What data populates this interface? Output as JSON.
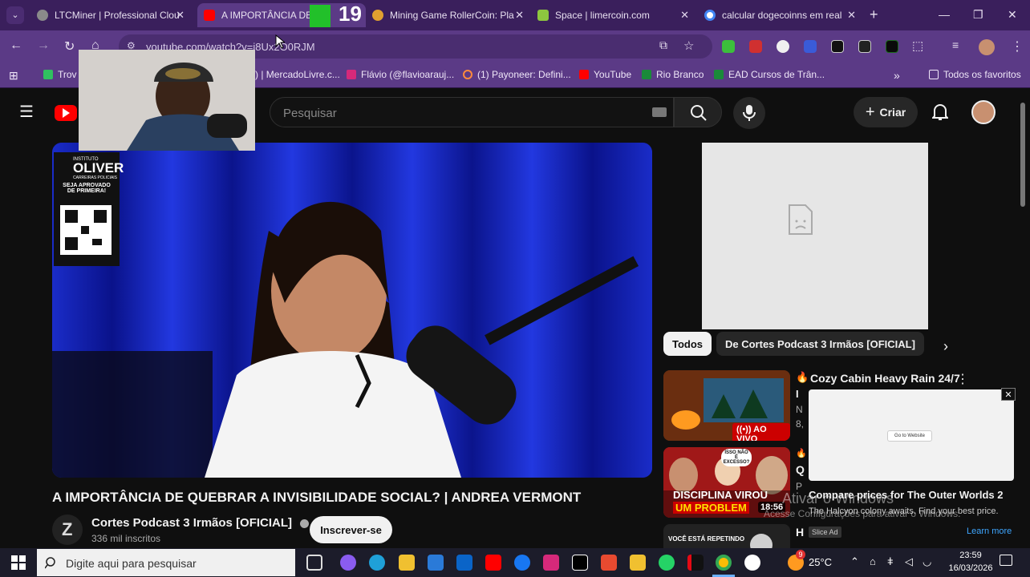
{
  "browser": {
    "tabs": [
      {
        "label": "LTCMiner | Professional Clou",
        "active": false
      },
      {
        "label": "A IMPORTÂNCIA DE Q",
        "active": true
      },
      {
        "label": "Mining Game RollerCoin: Pla",
        "active": false
      },
      {
        "label": "Space | limercoin.com",
        "active": false
      },
      {
        "label": "calcular dogecoinns em real",
        "active": false
      }
    ],
    "overlay_badge": "19",
    "new_tab": "+",
    "url": "youtube.com/watch?v=j8Ux2O0RJM",
    "bookmarks": [
      {
        "label": "Trov"
      },
      {
        "label": ") | MercadoLivre.c..."
      },
      {
        "label": "Flávio (@flavioarauj..."
      },
      {
        "label": "(1) Payoneer: Defini..."
      },
      {
        "label": "YouTube"
      },
      {
        "label": "Rio Branco"
      },
      {
        "label": "EAD Cursos de Trân..."
      }
    ],
    "all_bookmarks": "Todos os favoritos"
  },
  "youtube": {
    "search_placeholder": "Pesquisar",
    "create_label": "Criar",
    "video_title": "A IMPORTÂNCIA DE QUEBRAR A INVISIBILIDADE SOCIAL? | ANDREA VERMONT",
    "channel_name": "Cortes Podcast 3 Irmãos [OFICIAL]",
    "subscribers": "336 mil inscritos",
    "subscribe_label": "Inscrever-se",
    "video_overlay": {
      "brand": "OLIVER",
      "brand_top": "INSTITUTO",
      "brand_sub": "CARREIRAS POLICIAIS",
      "slogan": "SEJA APROVADO DE PRIMEIRA!"
    },
    "chips": [
      "Todos",
      "De Cortes Podcast 3 Irmãos [OFICIAL]"
    ],
    "recommendations": [
      {
        "title": "Cozy Cabin Heavy Rain 24/7",
        "badge": "AO VIVO",
        "meta1": "I",
        "meta2": "N",
        "meta3": "8,"
      },
      {
        "title": "Q",
        "thumb_text1": "DISCIPLINA VIROU",
        "thumb_text2": "UM PROBLEM",
        "thumb_bubble": "ISSO NÃO É EXCESSO?",
        "duration": "18:56",
        "meta1": "P"
      },
      {
        "title": "H",
        "thumb_text": "VOCÊ ESTÁ REPETINDO"
      }
    ],
    "ad": {
      "button": "Go to Website",
      "title": "Compare prices for The Outer Worlds 2",
      "description": "The Halcyon colony awaits. Find your best price.",
      "badge": "Slice Ad",
      "learn_more": "Learn more"
    },
    "watermark": {
      "line1": "Ativar o Windows",
      "line2": "Acesse Configurações para ativar o Windows."
    }
  },
  "taskbar": {
    "search_placeholder": "Digite aqui para pesquisar",
    "notification_count": "9",
    "weather": "25°C",
    "time": "23:59",
    "date": "16/03/2026"
  }
}
